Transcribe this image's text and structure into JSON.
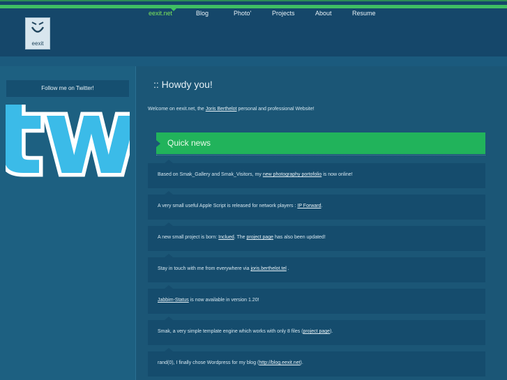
{
  "nav": {
    "items": [
      {
        "label": "eexit.net",
        "active": true
      },
      {
        "label": "Blog"
      },
      {
        "label": "Photo'"
      },
      {
        "label": "Projects"
      },
      {
        "label": "About"
      },
      {
        "label": "Resume"
      }
    ]
  },
  "logo": {
    "text": "eexit"
  },
  "sidebar": {
    "twitter_label": "Follow me on Twitter!",
    "tw_logo_text": "tw"
  },
  "main": {
    "heading": ":: Howdy you!",
    "welcome": {
      "before": "Welcome on eexit.net, the ",
      "link": "Joris Berthelot",
      "after": " personal and professional Website!"
    },
    "quick_news_title": "Quick news",
    "news": [
      {
        "parts": [
          {
            "t": "Based on Smak_Gallery and Smak_Visitors, my "
          },
          {
            "t": "new photography portofolio",
            "link": true
          },
          {
            "t": " is now online!"
          }
        ]
      },
      {
        "parts": [
          {
            "t": "A very small useful Apple Script is released for network players : "
          },
          {
            "t": "IP Forward",
            "link": true
          },
          {
            "t": "."
          }
        ]
      },
      {
        "parts": [
          {
            "t": "A new small project is born: "
          },
          {
            "t": "Inclued",
            "link": true
          },
          {
            "t": ". The "
          },
          {
            "t": "project page",
            "link": true
          },
          {
            "t": " has also been updated!"
          }
        ]
      },
      {
        "parts": [
          {
            "t": "Stay in touch with me from everywhere via "
          },
          {
            "t": "joris.berthelot.tel",
            "link": true
          },
          {
            "t": " ."
          }
        ]
      },
      {
        "parts": [
          {
            "t": "Jabbim-Status",
            "link": true
          },
          {
            "t": " is now available in version 1.20!"
          }
        ]
      },
      {
        "parts": [
          {
            "t": "Smak, a very simple template engine which works with only 8 files ("
          },
          {
            "t": "project page",
            "link": true
          },
          {
            "t": ")."
          }
        ]
      },
      {
        "parts": [
          {
            "t": "rand(0), I finally chose Wordpress for my blog ("
          },
          {
            "t": "http://blog.eexit.net",
            "link": true
          },
          {
            "t": ")."
          }
        ]
      }
    ]
  },
  "colors": {
    "accent_green": "#21b35b",
    "nav_active": "#7ee85a",
    "twitter_blue": "#3bbbe8"
  }
}
